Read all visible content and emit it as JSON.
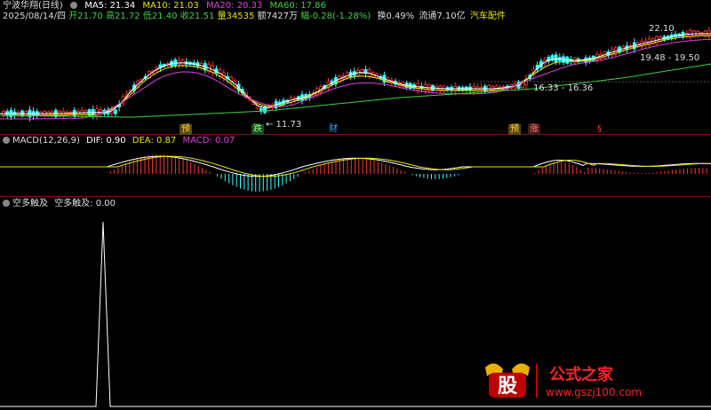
{
  "stock": {
    "title": "宁波华翔(日线)",
    "ma": [
      {
        "label": "MA5: 21.34",
        "color": "#ffffff"
      },
      {
        "label": "MA10: 21.03",
        "color": "#e6e600"
      },
      {
        "label": "MA20: 20.33",
        "color": "#e040e0"
      },
      {
        "label": "MA60: 17.86",
        "color": "#40d040"
      }
    ],
    "quote": {
      "date": "2025/08/14/四",
      "open": "开21.70",
      "high": "高21.72",
      "low": "低21.40",
      "close": "收21.51",
      "volume": "量34535",
      "amount": "额7427万",
      "change": "幅-0.28(-1.28%)",
      "turnover": "换0.49%",
      "float": "流通7.10亿",
      "sector": "汽车配件"
    }
  },
  "price_labels": {
    "high_value": "22.10",
    "low_value": "← 11.73",
    "range1": "19.48 - 19.50",
    "range2": "16.33 - 16.36"
  },
  "event_tags": [
    "预",
    "跌",
    "财",
    "预",
    "涨",
    "§"
  ],
  "macd": {
    "title": "MACD(12,26,9)",
    "dif": "DIF: 0.90",
    "dea": "DEA: 0.87",
    "macd": "MACD: 0.07",
    "dif_color": "#ffffff",
    "dea_color": "#e6e600",
    "macd_color": "#e040e0"
  },
  "indicator": {
    "title": "空多触及",
    "value": "空多触及: 0.00"
  },
  "watermark": {
    "logo": "股",
    "name": "公式之家",
    "url": "www.gszj100.com"
  },
  "colors": {
    "up": "#ff3333",
    "down": "#33ffff",
    "grid": "#7a1010"
  }
}
